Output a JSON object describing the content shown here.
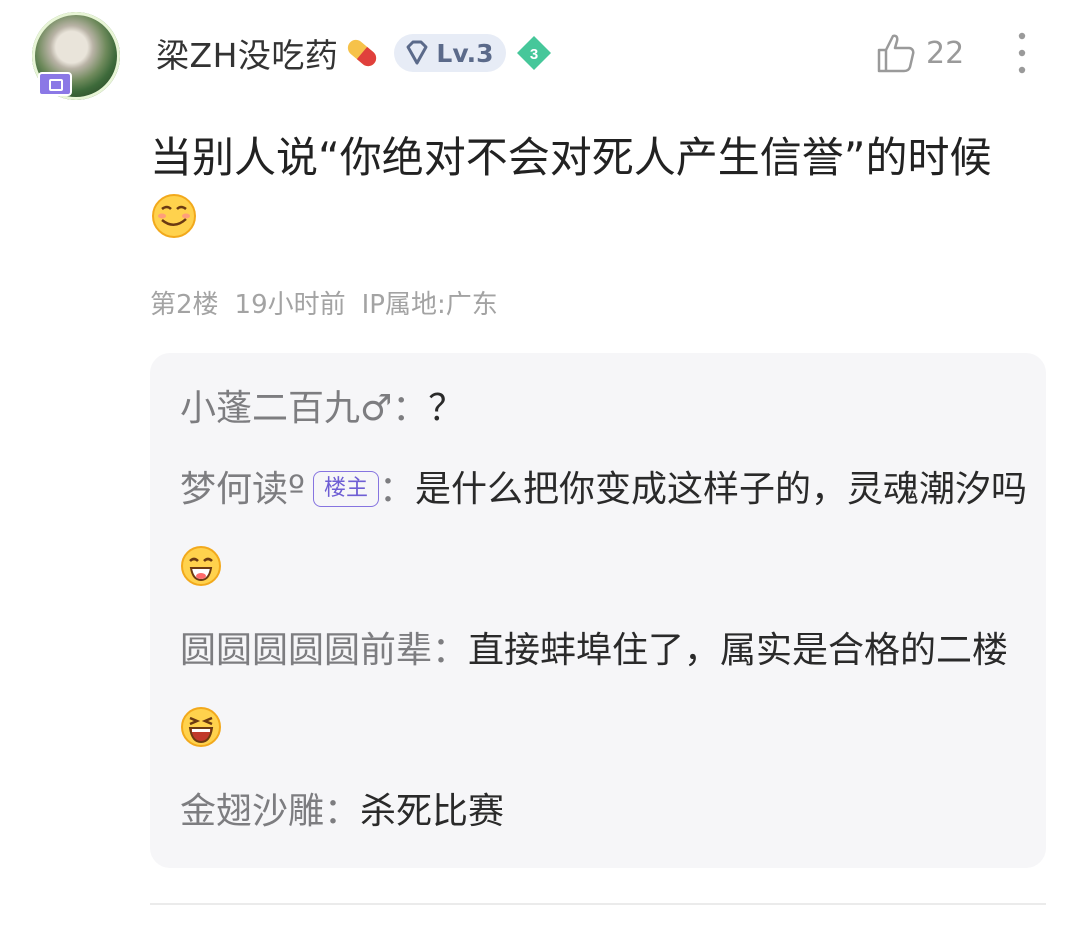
{
  "post": {
    "username": "梁ZH没吃药",
    "level": "Lv.3",
    "badge_number": "3",
    "likes": "22",
    "content": "当别人说“你绝对不会对死人产生信誉”的时候",
    "content_emoji": "grinning-smug-emoji",
    "floor": "第2楼",
    "time": "19小时前",
    "ip": "IP属地:广东"
  },
  "replies": [
    {
      "name": "小蓬二百九♂",
      "tag": "",
      "text": "？",
      "emoji": ""
    },
    {
      "name": "梦何读º",
      "tag": "楼主",
      "text": "是什么把你变成这样子的，灵魂潮汐吗",
      "emoji": "laughing-emoji"
    },
    {
      "name": "圆圆圆圆圆前辈",
      "tag": "",
      "text": "直接蚌埠住了，属实是合格的二楼",
      "emoji": "squinting-laugh-emoji"
    },
    {
      "name": "金翅沙雕",
      "tag": "",
      "text": "杀死比赛",
      "emoji": ""
    }
  ],
  "colors": {
    "accent": "#8674e0",
    "level_badge_bg": "#e7ecf6",
    "green_badge": "#46c79a",
    "reply_bg": "#f6f6f8"
  }
}
